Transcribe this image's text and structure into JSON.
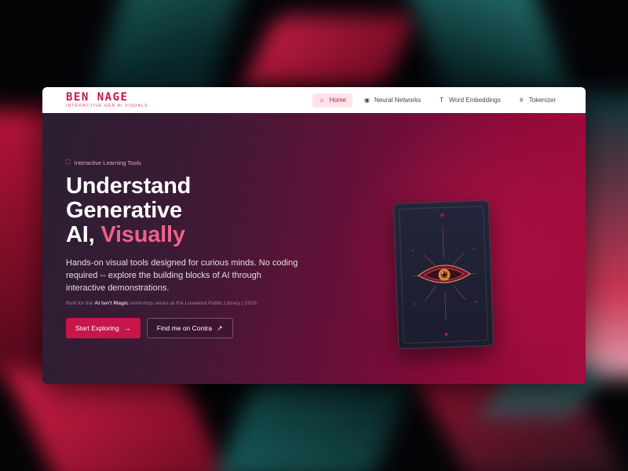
{
  "brand": {
    "logo": "BEN NAGE",
    "tagline": "INTERACTIVE GEN AI VISUALS"
  },
  "nav": {
    "items": [
      {
        "label": "Home",
        "icon": "home-icon",
        "active": true
      },
      {
        "label": "Neural Networks",
        "icon": "brain-icon",
        "active": false
      },
      {
        "label": "Word Embeddings",
        "icon": "text-icon",
        "active": false
      },
      {
        "label": "Tokenizer",
        "icon": "hash-icon",
        "active": false
      }
    ]
  },
  "hero": {
    "eyebrow": "Interactive Learning Tools",
    "headline_line1": "Understand",
    "headline_line2": "Generative",
    "headline_line3_prefix": "AI, ",
    "headline_line3_accent": "Visually",
    "lead": "Hands-on visual tools designed for curious minds. No coding required -- explore the building blocks of AI through interactive demonstrations.",
    "fineprint_prefix": "Built for the ",
    "fineprint_bold": "AI Isn't Magic",
    "fineprint_suffix": " workshop series at the Loveland Public Library | 2026",
    "primary_cta": "Start Exploring",
    "secondary_cta": "Find me on Contra"
  },
  "colors": {
    "accent": "#c8154a",
    "accent_light": "#f0608c",
    "nav_active_bg": "#fce4ea"
  }
}
